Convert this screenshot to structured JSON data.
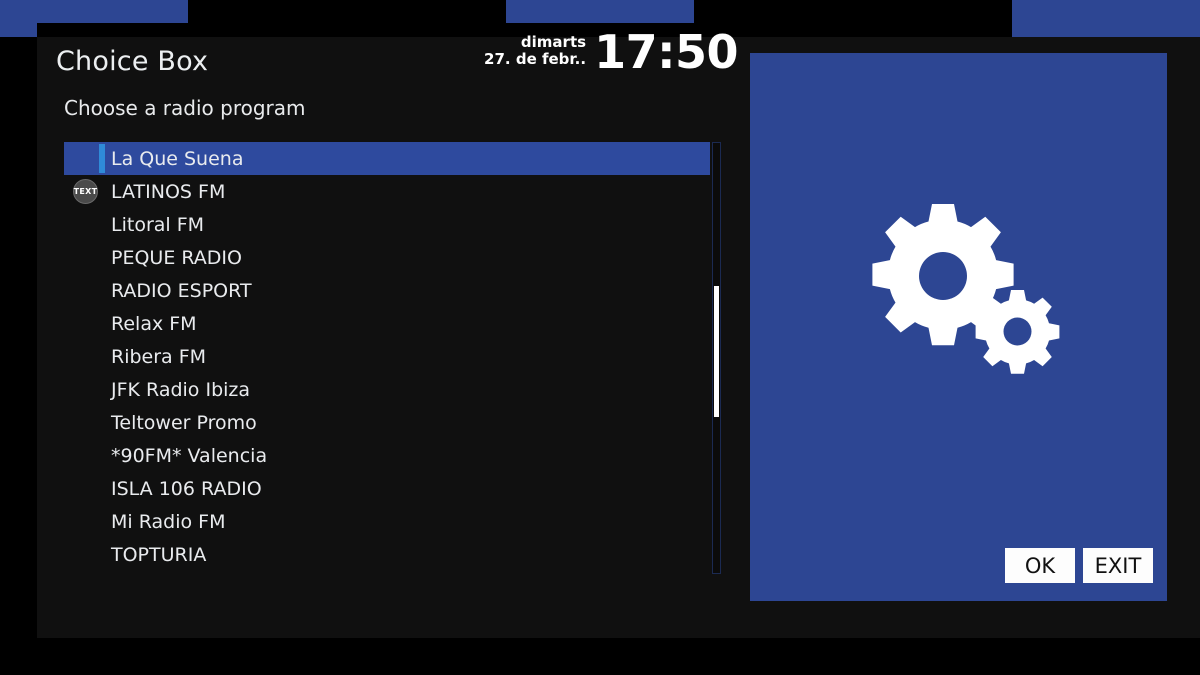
{
  "window": {
    "title": "Choice Box",
    "subtitle": "Choose a radio program",
    "background_color": "#101010",
    "accent_color": "#2d4693"
  },
  "clock": {
    "weekday": "dimarts",
    "date": "27. de febr..",
    "time": "17:50"
  },
  "list": {
    "selected_index": 0,
    "selected_color": "#2e4a9e",
    "accent_bar_color": "#2f8bd8",
    "items": [
      {
        "label": "La Que Suena",
        "selected": true,
        "badge": ""
      },
      {
        "label": "LATINOS FM",
        "selected": false,
        "badge": "TEXT"
      },
      {
        "label": "Litoral FM",
        "selected": false,
        "badge": ""
      },
      {
        "label": "PEQUE RADIO",
        "selected": false,
        "badge": ""
      },
      {
        "label": "RADIO ESPORT",
        "selected": false,
        "badge": ""
      },
      {
        "label": "Relax FM",
        "selected": false,
        "badge": ""
      },
      {
        "label": "Ribera FM",
        "selected": false,
        "badge": ""
      },
      {
        "label": "JFK Radio Ibiza",
        "selected": false,
        "badge": ""
      },
      {
        "label": "Teltower Promo",
        "selected": false,
        "badge": ""
      },
      {
        "label": "*90FM* Valencia",
        "selected": false,
        "badge": ""
      },
      {
        "label": "ISLA 106 RADIO",
        "selected": false,
        "badge": ""
      },
      {
        "label": "Mi Radio FM",
        "selected": false,
        "badge": ""
      },
      {
        "label": "TOPTURIA",
        "selected": false,
        "badge": ""
      }
    ]
  },
  "scrollbar": {
    "thumb_color": "#ffffff",
    "track_color": "#0b0b0b"
  },
  "preview": {
    "icon": "gears-icon",
    "panel_color": "#2d4693",
    "buttons": [
      {
        "label": "OK"
      },
      {
        "label": "EXIT"
      }
    ]
  }
}
